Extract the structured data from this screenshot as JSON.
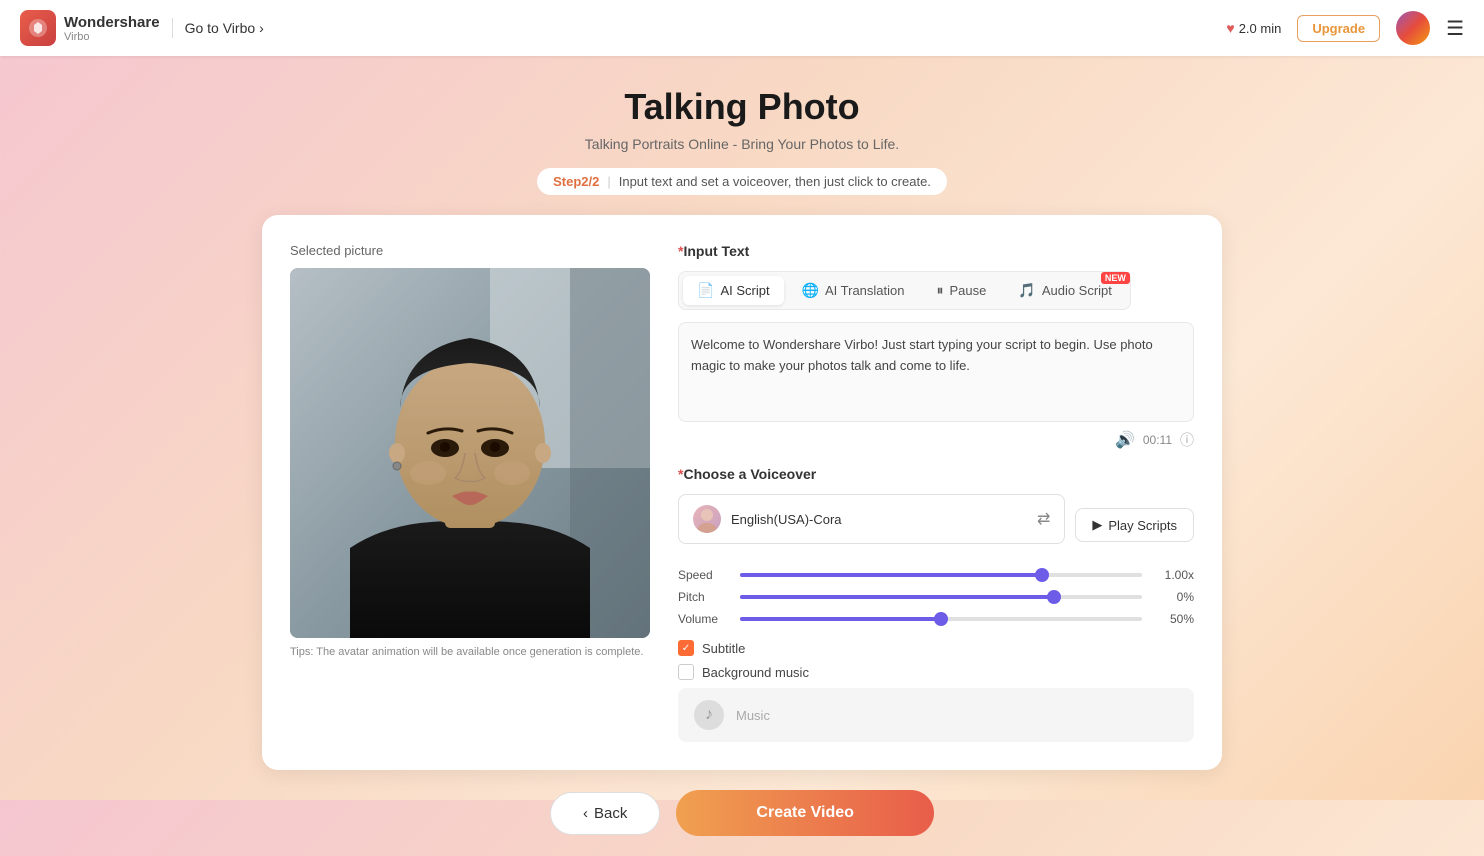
{
  "header": {
    "brand_name": "Wondershare",
    "brand_sub": "Virbo",
    "go_to_virbo": "Go to Virbo",
    "mins_label": "2.0 min",
    "upgrade_label": "Upgrade"
  },
  "hero": {
    "title": "Talking Photo",
    "subtitle": "Talking Portraits Online - Bring Your Photos to Life.",
    "step_label": "Step2/2",
    "step_description": "Input text and set a voiceover, then just click to create."
  },
  "left_panel": {
    "selected_picture_label": "Selected picture",
    "tips_text": "Tips: The avatar animation will be available once generation is complete."
  },
  "input_text": {
    "section_title": "Input Text",
    "tabs": [
      {
        "id": "ai-script",
        "label": "AI Script",
        "icon": "📄",
        "active": true,
        "new": false
      },
      {
        "id": "ai-translation",
        "label": "AI Translation",
        "icon": "🌐",
        "active": false,
        "new": false
      },
      {
        "id": "pause",
        "label": "Pause",
        "icon": "⏸",
        "active": false,
        "new": false
      },
      {
        "id": "audio-script",
        "label": "Audio Script",
        "icon": "🎵",
        "active": false,
        "new": true
      }
    ],
    "placeholder_text": "Welcome to Wondershare Virbo! Just start typing your script to begin. Use photo magic to make your photos talk and come to life.",
    "time_display": "00:11"
  },
  "voiceover": {
    "section_title": "Choose a Voiceover",
    "voice_name": "English(USA)-Cora",
    "play_scripts_label": "Play Scripts",
    "sliders": [
      {
        "label": "Speed",
        "fill_pct": 75,
        "thumb_pct": 75,
        "value": "1.00x"
      },
      {
        "label": "Pitch",
        "fill_pct": 78,
        "thumb_pct": 78,
        "value": "0%"
      },
      {
        "label": "Volume",
        "fill_pct": 50,
        "thumb_pct": 50,
        "value": "50%"
      }
    ]
  },
  "subtitle": {
    "label": "Subtitle",
    "checked": true
  },
  "background_music": {
    "label": "Background music",
    "checked": false,
    "music_placeholder": "Music"
  },
  "actions": {
    "back_label": "Back",
    "create_label": "Create Video"
  }
}
